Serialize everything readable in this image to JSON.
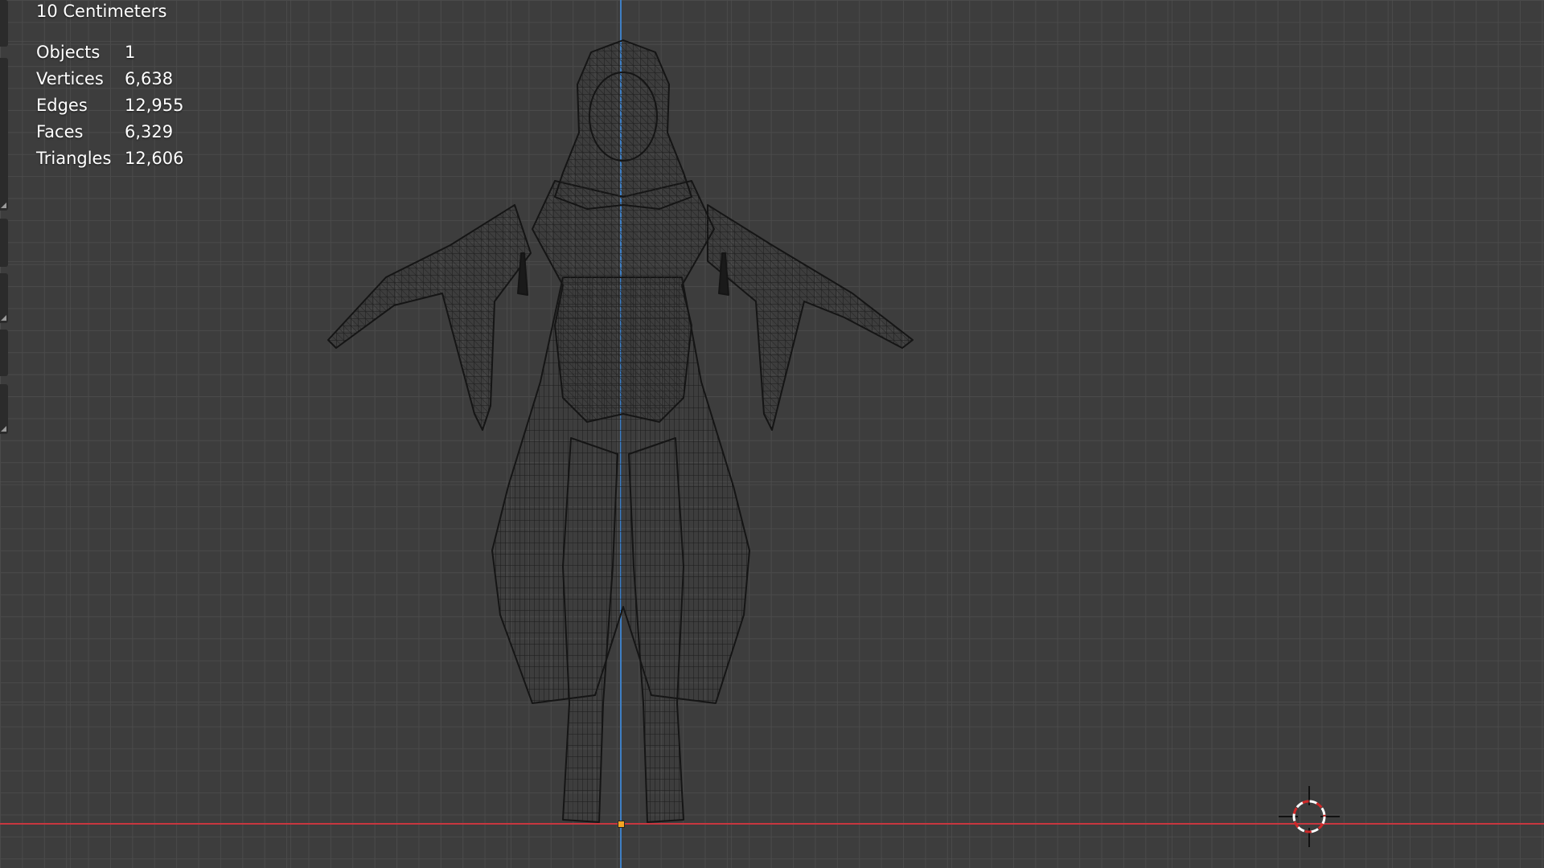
{
  "viewport": {
    "scale_label": "10 Centimeters",
    "stats": [
      {
        "label": "Objects",
        "value": "1"
      },
      {
        "label": "Vertices",
        "value": "6,638"
      },
      {
        "label": "Edges",
        "value": "12,955"
      },
      {
        "label": "Faces",
        "value": "6,329"
      },
      {
        "label": "Triangles",
        "value": "12,606"
      }
    ]
  },
  "colors": {
    "background": "#3d3d3d",
    "grid": "#4a4a4a",
    "axis_z": "#3f7fc4",
    "axis_x": "#c8363f",
    "wireframe": "#1a1a1a",
    "origin": "#f5a623"
  },
  "icons": {
    "cursor": "3d-cursor-icon",
    "origin": "object-origin-icon"
  }
}
